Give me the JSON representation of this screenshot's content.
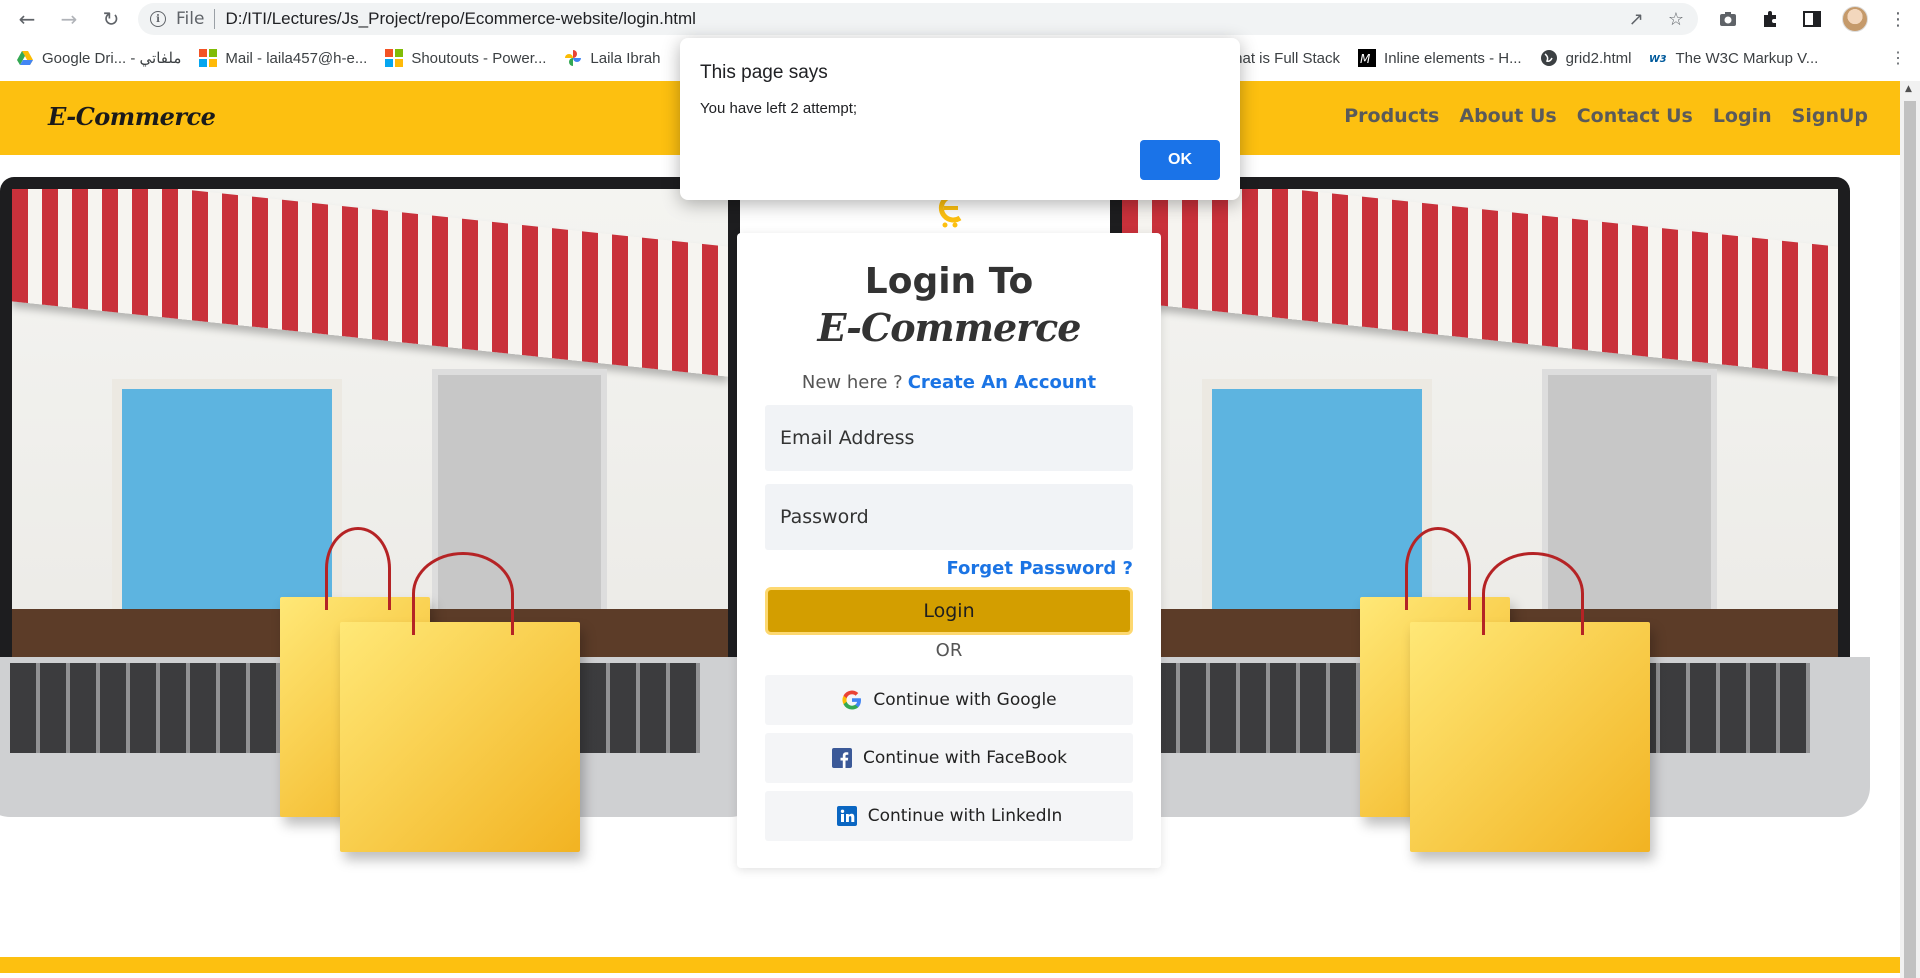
{
  "browser": {
    "scheme_label": "File",
    "url": "D:/ITI/Lectures/Js_Project/repo/Ecommerce-website/login.html",
    "bookmarks": [
      {
        "label": "Google Dri... - ملفاتي",
        "icon": "google-drive-icon"
      },
      {
        "label": "Mail - laila457@h-e...",
        "icon": "microsoft-icon"
      },
      {
        "label": "Shoutouts - Power...",
        "icon": "microsoft-icon"
      },
      {
        "label": "Laila Ibrah",
        "icon": "google-photos-icon"
      },
      {
        "label": "What is Full Stack",
        "icon": ""
      },
      {
        "label": "Inline elements - H...",
        "icon": "mdn-icon"
      },
      {
        "label": "grid2.html",
        "icon": "globe-icon"
      },
      {
        "label": "The W3C Markup V...",
        "icon": "w3c-icon"
      }
    ],
    "more_bookmarks": "⋮"
  },
  "site": {
    "logo": "E-Commerce",
    "nav": [
      "Products",
      "About Us",
      "Contact Us",
      "Login",
      "SignUp"
    ]
  },
  "login": {
    "title": "Login To",
    "brand": "E-Commerce",
    "new_here": "New here ?",
    "create_account": "Create An Account",
    "email_placeholder": "Email Address",
    "password_placeholder": "Password",
    "forgot": "Forget Password ?",
    "login_button": "Login",
    "or": "OR",
    "google": "Continue with Google",
    "facebook": "Continue with FaceBook",
    "linkedin": "Continue with LinkedIn"
  },
  "dialog": {
    "title": "This page says",
    "message": "You have left 2 attempt;",
    "ok": "OK"
  },
  "colors": {
    "accent_yellow": "#fdc010",
    "link_blue": "#1b74e4",
    "login_button": "#d39e00",
    "dialog_ok": "#1a73e8"
  }
}
